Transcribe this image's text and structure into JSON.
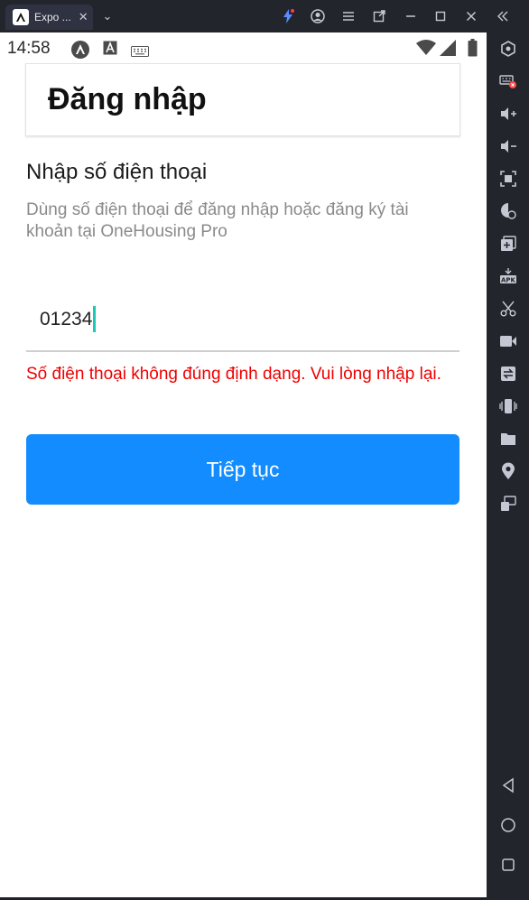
{
  "window": {
    "tab_title": "Expo ...",
    "tab_close": "✕",
    "tab_dropdown": "⌄",
    "controls": [
      "menu",
      "minimize",
      "maximize",
      "close",
      "collapse"
    ]
  },
  "status_bar": {
    "time": "14:58"
  },
  "header": {
    "title": "Đăng nhập"
  },
  "form": {
    "section_title": "Nhập số điện thoại",
    "description": "Dùng số điện thoại để đăng nhập hoặc đăng ký tài khoản tại OneHousing Pro",
    "phone_value": "01234",
    "error_message": "Số điện thoại không đúng định dạng. Vui lòng nhập lại.",
    "continue_label": "Tiếp tục"
  },
  "colors": {
    "primary": "#138cff",
    "error": "#f00000",
    "caret": "#19c9b7"
  }
}
